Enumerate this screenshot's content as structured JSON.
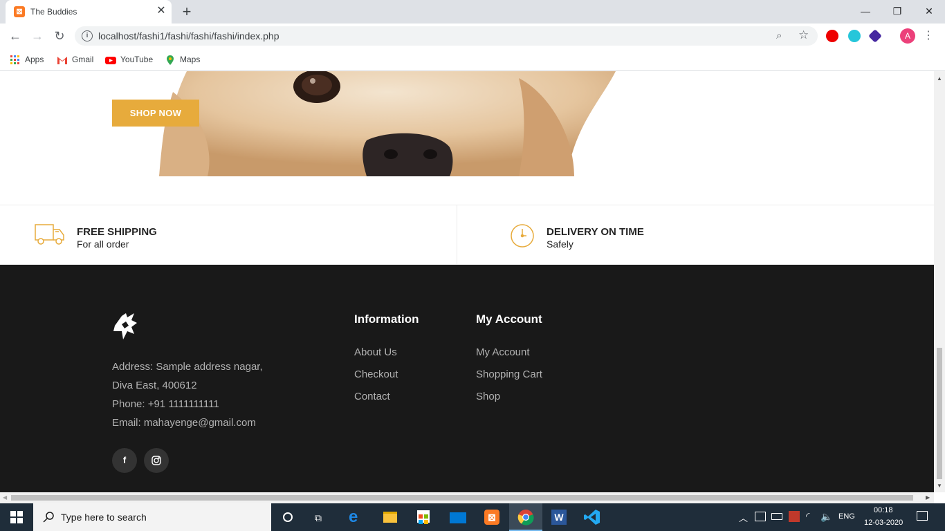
{
  "browser": {
    "tab_title": "The Buddies",
    "url": "localhost/fashi1/fashi/fashi/fashi/index.php",
    "avatar_letter": "A",
    "bookmarks": [
      "Apps",
      "Gmail",
      "YouTube",
      "Maps"
    ]
  },
  "hero": {
    "shop_button": "SHOP NOW"
  },
  "benefits": [
    {
      "title": "FREE SHIPPING",
      "subtitle": "For all order",
      "icon": "truck-icon"
    },
    {
      "title": "DELIVERY ON TIME",
      "subtitle": "Safely",
      "icon": "clock-icon"
    }
  ],
  "footer": {
    "address_line1": "Address: Sample address nagar,",
    "address_line2": "Diva East, 400612",
    "phone": "Phone: +91 1111111111",
    "email": "Email: mahayenge@gmail.com",
    "information": {
      "heading": "Information",
      "links": [
        "About Us",
        "Checkout",
        "Contact"
      ]
    },
    "account": {
      "heading": "My Account",
      "links": [
        "My Account",
        "Shopping Cart",
        "Shop"
      ]
    },
    "social": [
      "f",
      "instagram-icon"
    ]
  },
  "taskbar": {
    "search_placeholder": "Type here to search",
    "language": "ENG",
    "time": "00:18",
    "date": "12-03-2020"
  },
  "colors": {
    "accent": "#e7ab3c",
    "footer_bg": "#191919",
    "taskbar_bg": "#1f2d3a"
  }
}
